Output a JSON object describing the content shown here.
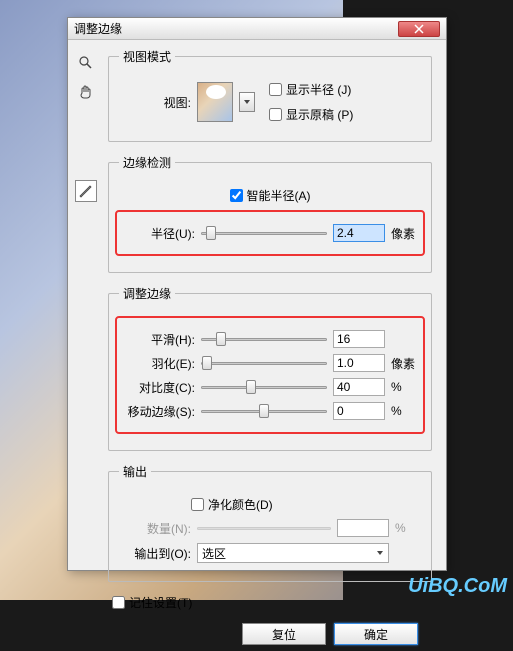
{
  "dialog": {
    "title": "调整边缘"
  },
  "view_mode": {
    "legend": "视图模式",
    "view_label": "视图:",
    "show_radius": "显示半径 (J)",
    "show_original": "显示原稿 (P)"
  },
  "edge_detect": {
    "legend": "边缘检测",
    "smart_radius": "智能半径(A)",
    "radius_label": "半径(U):",
    "radius_value": "2.4",
    "radius_unit": "像素"
  },
  "adjust_edge": {
    "legend": "调整边缘",
    "smooth_label": "平滑(H):",
    "smooth_value": "16",
    "feather_label": "羽化(E):",
    "feather_value": "1.0",
    "feather_unit": "像素",
    "contrast_label": "对比度(C):",
    "contrast_value": "40",
    "contrast_unit": "%",
    "shift_label": "移动边缘(S):",
    "shift_value": "0",
    "shift_unit": "%"
  },
  "output": {
    "legend": "输出",
    "decontaminate": "净化颜色(D)",
    "amount_label": "数量(N):",
    "amount_unit": "%",
    "output_to_label": "输出到(O):",
    "output_to_value": "选区"
  },
  "remember": "记住设置(T)",
  "buttons": {
    "reset": "复位",
    "ok": "确定"
  },
  "watermark": "UiBQ.CoM"
}
